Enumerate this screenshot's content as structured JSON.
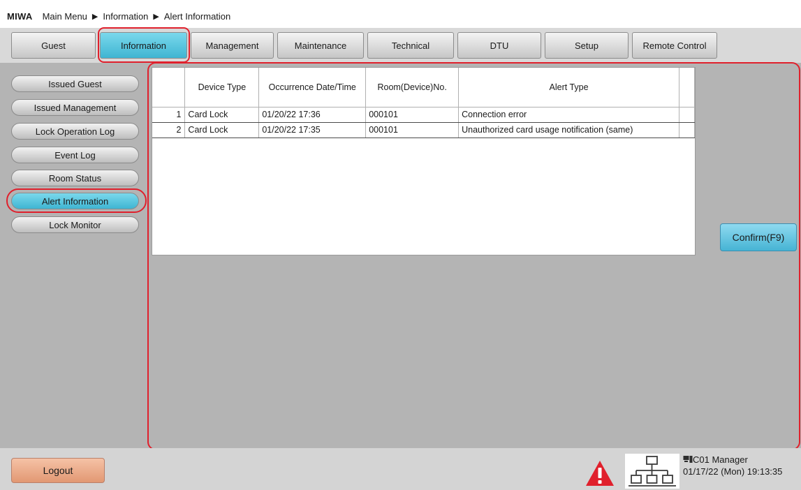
{
  "breadcrumb": {
    "brand": "MIWA",
    "items": [
      "Main Menu",
      "Information",
      "Alert Information"
    ]
  },
  "tabs": [
    {
      "label": "Guest",
      "active": false
    },
    {
      "label": "Information",
      "active": true
    },
    {
      "label": "Management",
      "active": false
    },
    {
      "label": "Maintenance",
      "active": false
    },
    {
      "label": "Technical",
      "active": false
    },
    {
      "label": "DTU",
      "active": false
    },
    {
      "label": "Setup",
      "active": false
    },
    {
      "label": "Remote Control",
      "active": false
    }
  ],
  "sidebar": {
    "items": [
      {
        "label": "Issued Guest",
        "active": false
      },
      {
        "label": "Issued Management",
        "active": false
      },
      {
        "label": "Lock Operation Log",
        "active": false
      },
      {
        "label": "Event Log",
        "active": false
      },
      {
        "label": "Room Status",
        "active": false
      },
      {
        "label": "Alert Information",
        "active": true
      },
      {
        "label": "Lock Monitor",
        "active": false
      }
    ]
  },
  "alert_table": {
    "columns": [
      "",
      "Device Type",
      "Occurrence Date/Time",
      "Room(Device)No.",
      "Alert Type",
      ""
    ],
    "rows": [
      {
        "no": "1",
        "device_type": "Card Lock",
        "datetime": "01/20/22 17:36",
        "room": "000101",
        "alert_type": "Connection error"
      },
      {
        "no": "2",
        "device_type": "Card Lock",
        "datetime": "01/20/22 17:35",
        "room": "000101",
        "alert_type": "Unauthorized card usage notification (same)"
      }
    ]
  },
  "confirm_button": "Confirm(F9)",
  "logout_button": "Logout",
  "status": {
    "terminal_user": "C01 Manager",
    "datetime": "01/17/22 (Mon) 19:13:35",
    "icons": [
      "warning-icon",
      "network-icon",
      "computer-icon"
    ]
  },
  "colors": {
    "active_tab": "#3fb5d2",
    "highlight_ring": "#e0202c",
    "logout": "#e29873",
    "warning": "#e0202c"
  }
}
